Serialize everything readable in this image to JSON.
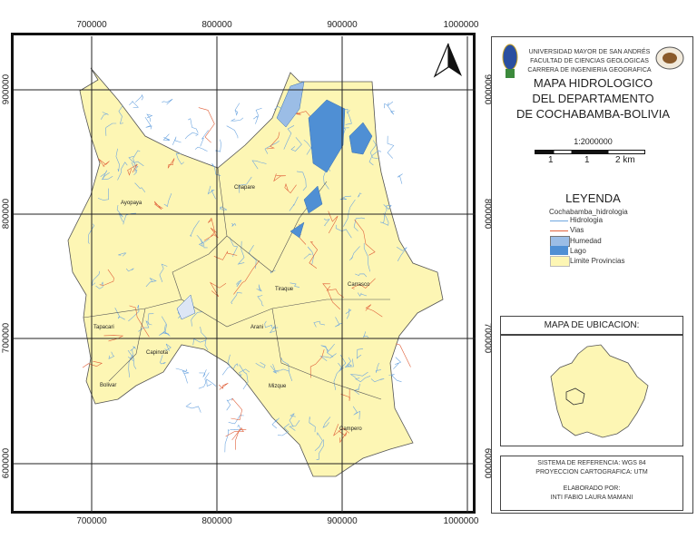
{
  "map": {
    "x_ticks": [
      "700000",
      "800000",
      "900000",
      "1000000"
    ],
    "y_ticks": [
      "900000",
      "800000",
      "700000",
      "600000"
    ],
    "north_arrow": "north-arrow-icon",
    "provinces": [
      "Ayopaya",
      "Chapare",
      "Tiraque",
      "Carrasco",
      "Tapacari",
      "Capinota",
      "Arani",
      "Bolivar",
      "Mizque",
      "Campero"
    ],
    "colors": {
      "province_fill": "#fdf6b4",
      "river": "#6ea6e0",
      "road": "#e0603a",
      "lake": "#4f8fd4",
      "wetland": "#9bbde6"
    }
  },
  "panel": {
    "institution": [
      "UNIVERSIDAD MAYOR DE SAN ANDRÉS",
      "FACULTAD DE CIENCIAS GEOLOGICAS",
      "CARRERA DE INGENIERIA GEOGRAFICA"
    ],
    "title": [
      "MAPA HIDROLOGICO",
      "DEL DEPARTAMENTO",
      "DE COCHABAMBA-BOLIVIA"
    ],
    "scale_text": "1:2000000",
    "scale_labels": [
      "1",
      "1",
      "2 km"
    ],
    "legend": {
      "heading": "LEYENDA",
      "layer": "Cochabamba_hidrologia",
      "items": [
        "Hidrologia",
        "Vias",
        "Humedad",
        "Lago",
        "Limite Provincias"
      ]
    },
    "location_title": "MAPA DE UBICACION:",
    "reference": [
      "SISTEMA DE REFERENCIA: WGS 84",
      "PROYECCION CARTOGRAFICA: UTM"
    ],
    "author_label": "ELABORADO POR:",
    "author": "INTI FABIO LAURA MAMANI"
  }
}
